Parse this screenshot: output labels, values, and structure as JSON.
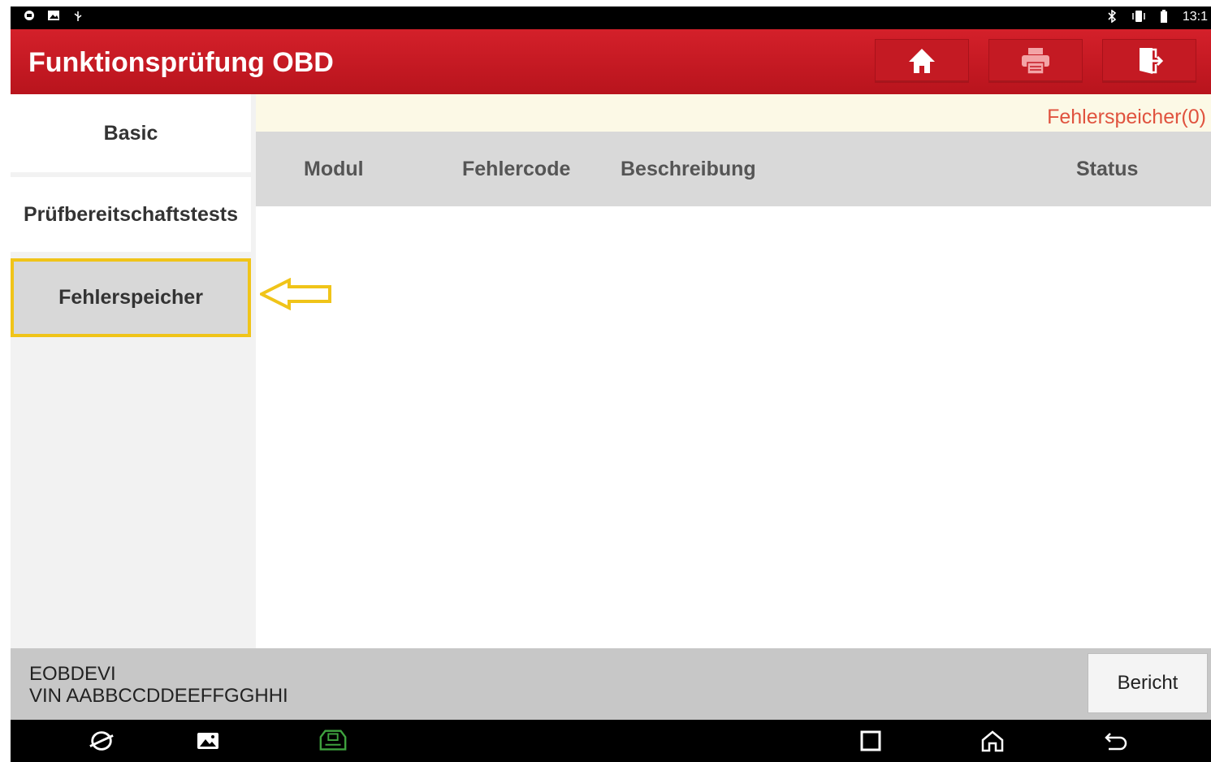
{
  "status_bar": {
    "left_icons": [
      "notification-icon",
      "image-icon",
      "usb-icon"
    ],
    "right_icons": [
      "bluetooth-icon",
      "vibrate-icon",
      "battery-icon"
    ],
    "time": "13:1"
  },
  "header": {
    "title": "Funktionsprüfung OBD",
    "buttons": [
      "home-icon",
      "print-icon",
      "exit-icon"
    ]
  },
  "sidebar": {
    "items": [
      {
        "label": "Basic",
        "active": false
      },
      {
        "label": "Prüfbereitschaftstests",
        "active": false
      },
      {
        "label": "Fehlerspeicher",
        "active": true
      }
    ]
  },
  "main": {
    "notice": "Fehlerspeicher(0)",
    "columns": [
      "Modul",
      "Fehlercode",
      "Beschreibung",
      "Status"
    ],
    "rows": []
  },
  "footer": {
    "line1": "EOBDEVI",
    "line2": "VIN AABBCCDDEEFFGGHHI",
    "report_button": "Bericht"
  },
  "annotation": {
    "color": "#f0c419"
  },
  "colors": {
    "header_red": "#c41a23",
    "notice_red": "#e0533f",
    "highlight_yellow": "#f0c419"
  }
}
